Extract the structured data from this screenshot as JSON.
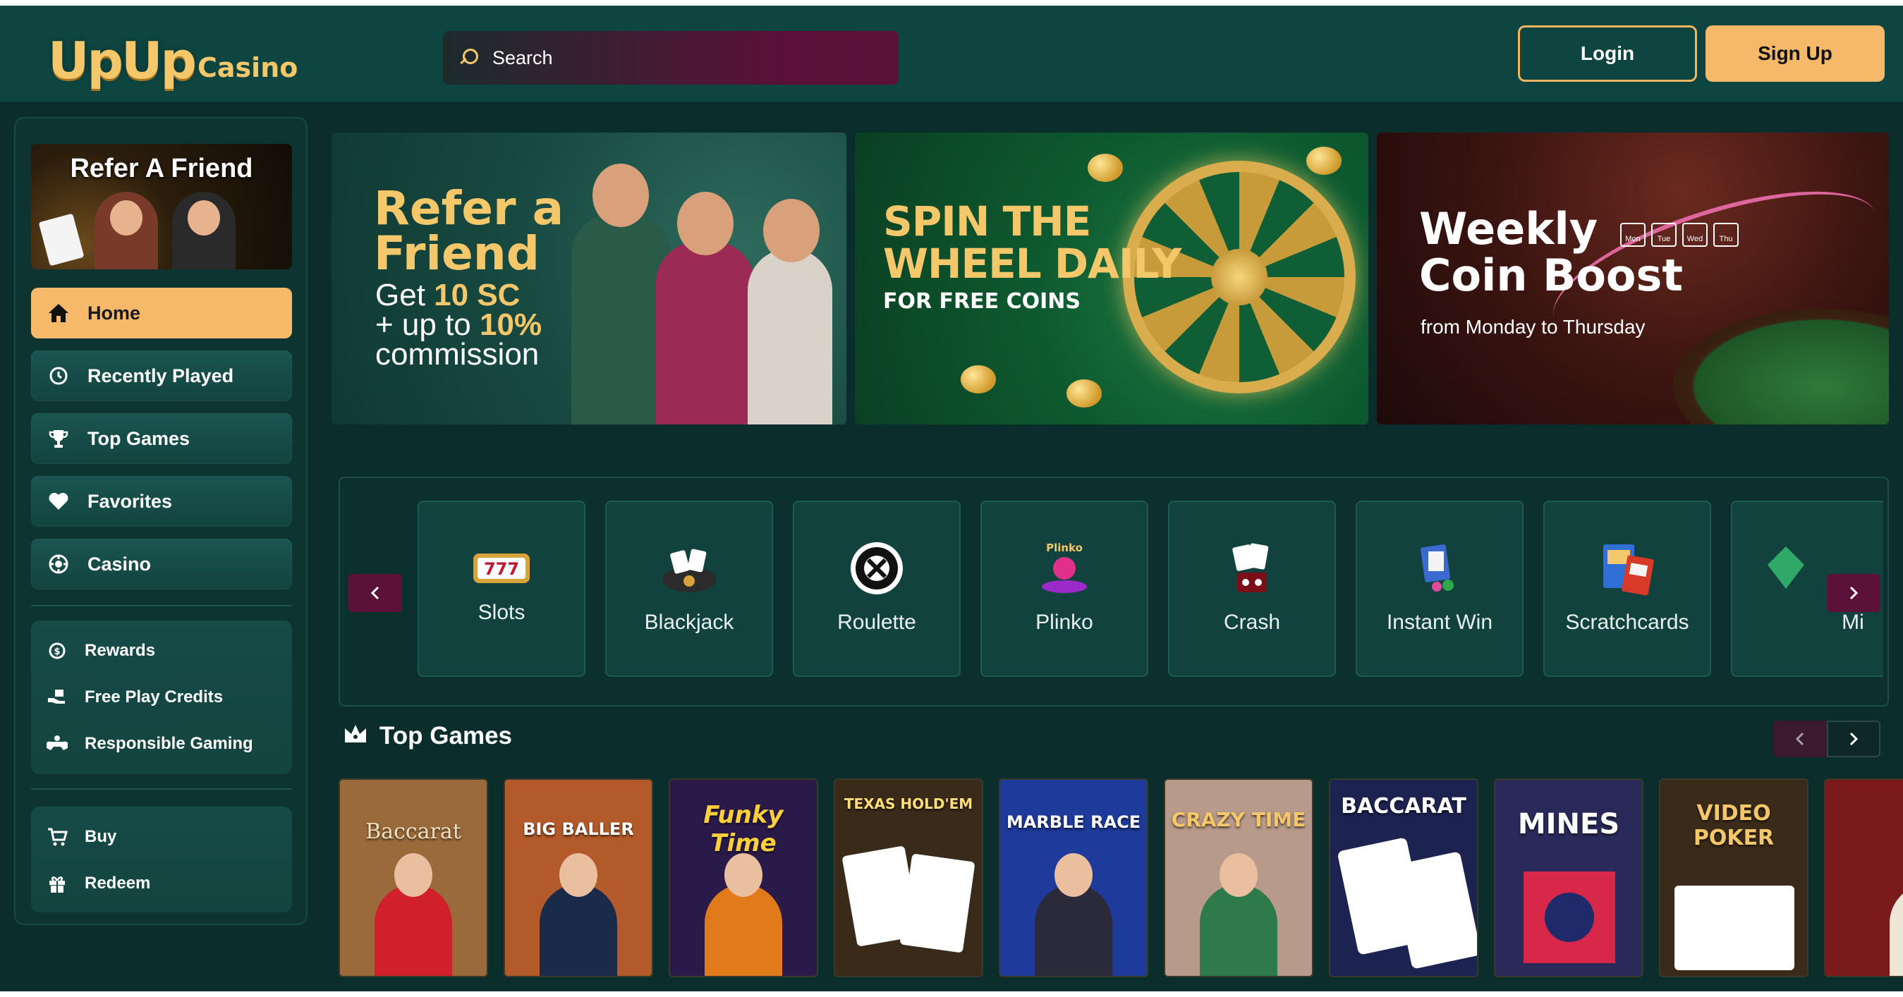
{
  "header": {
    "logo_main": "UpUp",
    "logo_sub": "Casino",
    "search_placeholder": "Search",
    "login_label": "Login",
    "signup_label": "Sign Up"
  },
  "sidebar": {
    "promo_title": "Refer A Friend",
    "nav": [
      {
        "label": "Home",
        "icon": "home-icon",
        "active": true
      },
      {
        "label": "Recently Played",
        "icon": "history-icon"
      },
      {
        "label": "Top Games",
        "icon": "trophy-icon"
      },
      {
        "label": "Favorites",
        "icon": "heart-icon"
      },
      {
        "label": "Casino",
        "icon": "chip-icon"
      }
    ],
    "group1": [
      {
        "label": "Rewards",
        "icon": "rewards-icon"
      },
      {
        "label": "Free Play Credits",
        "icon": "gift-hand-icon"
      },
      {
        "label": "Responsible Gaming",
        "icon": "gamepad-icon"
      }
    ],
    "group2": [
      {
        "label": "Buy",
        "icon": "cart-icon"
      },
      {
        "label": "Redeem",
        "icon": "gift-icon"
      }
    ]
  },
  "banners": {
    "refer": {
      "line1": "Refer a",
      "line2": "Friend",
      "get": "Get ",
      "amount": "10 SC",
      "plus": "+ up to ",
      "percent": "10%",
      "commission": "commission"
    },
    "wheel": {
      "line1": "SPIN THE",
      "line2": "WHEEL DAILY",
      "sub": "FOR FREE COINS"
    },
    "boost": {
      "line1": "Weekly",
      "line2": "Coin Boost",
      "sub": "from Monday to Thursday",
      "days": [
        "Mon",
        "Tue",
        "Wed",
        "Thu"
      ]
    }
  },
  "categories": [
    {
      "label": "Slots",
      "icon": "slot-machine-icon"
    },
    {
      "label": "Blackjack",
      "icon": "blackjack-icon"
    },
    {
      "label": "Roulette",
      "icon": "roulette-icon"
    },
    {
      "label": "Plinko",
      "icon": "plinko-icon"
    },
    {
      "label": "Crash",
      "icon": "crash-icon"
    },
    {
      "label": "Instant Win",
      "icon": "instant-win-icon"
    },
    {
      "label": "Scratchcards",
      "icon": "scratchcard-icon"
    },
    {
      "label": "Mi",
      "icon": "mines-icon"
    }
  ],
  "top_games": {
    "title": "Top Games",
    "games": [
      {
        "title": "Baccarat",
        "bg": "#9a6a3a"
      },
      {
        "title": "BIG BALLER",
        "bg": "#b35a2a"
      },
      {
        "title": "Funky Time",
        "bg": "#2a1a4a"
      },
      {
        "title": "TEXAS HOLD'EM",
        "bg": "#3a2a1a"
      },
      {
        "title": "MARBLE RACE",
        "bg": "#1e3a9a"
      },
      {
        "title": "CRAZY TIME",
        "bg": "#b89a8a"
      },
      {
        "title": "BACCARAT",
        "bg": "#1c2350"
      },
      {
        "title": "MINES",
        "bg": "#2a2a5a"
      },
      {
        "title": "VIDEO POKER",
        "bg": "#3a2a1a"
      },
      {
        "title": "",
        "bg": "#7a1a1a"
      }
    ]
  }
}
